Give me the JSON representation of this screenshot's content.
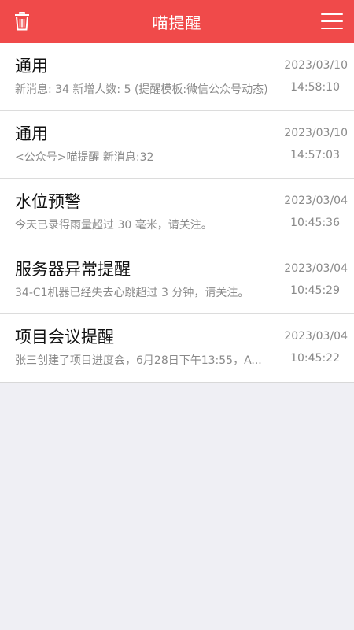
{
  "header": {
    "title": "喵提醒",
    "left_icon": "trash-icon",
    "right_icon": "menu-icon",
    "color": "#f04a4a"
  },
  "messages": [
    {
      "title": "通用",
      "subtitle": "新消息: 34 新增人数: 5 (提醒模板:微信公众号动态)",
      "date": "2023/03/10",
      "time": "14:58:10"
    },
    {
      "title": "通用",
      "subtitle": "<公众号>喵提醒 新消息:32",
      "date": "2023/03/10",
      "time": "14:57:03"
    },
    {
      "title": "水位预警",
      "subtitle": "今天已录得雨量超过 30 毫米，请关注。",
      "date": "2023/03/04",
      "time": "10:45:36"
    },
    {
      "title": "服务器异常提醒",
      "subtitle": "34-C1机器已经失去心跳超过 3 分钟，请关注。",
      "date": "2023/03/04",
      "time": "10:45:29"
    },
    {
      "title": "项目会议提醒",
      "subtitle": "张三创建了项目进度会，6月28日下午13:55，A...",
      "date": "2023/03/04",
      "time": "10:45:22"
    }
  ]
}
